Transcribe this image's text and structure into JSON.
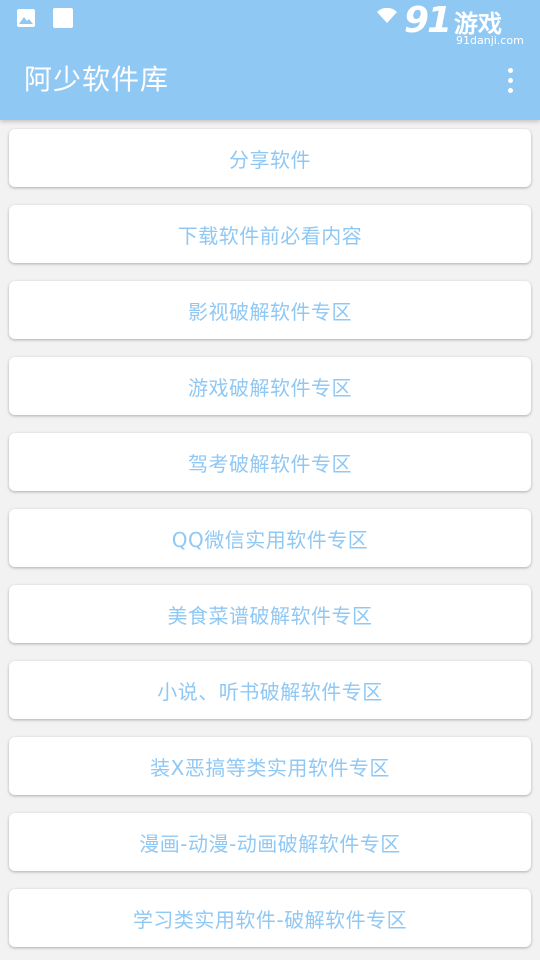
{
  "statusbar": {
    "icons": [
      "image-icon",
      "square-icon",
      "wifi-icon"
    ],
    "watermark_number": "91",
    "watermark_text": "游戏",
    "watermark_url": "91danji.com"
  },
  "appbar": {
    "title": "阿少软件库",
    "menu_icon": "overflow-menu-icon",
    "color": "#90c8f4"
  },
  "colors": {
    "accent": "#90c8f4",
    "card_bg": "#ffffff",
    "page_bg": "#f2f2f2"
  },
  "menu": {
    "items": [
      {
        "label": "分享软件"
      },
      {
        "label": "下载软件前必看内容"
      },
      {
        "label": "影视破解软件专区"
      },
      {
        "label": "游戏破解软件专区"
      },
      {
        "label": "驾考破解软件专区"
      },
      {
        "label": "QQ微信实用软件专区"
      },
      {
        "label": "美食菜谱破解软件专区"
      },
      {
        "label": "小说、听书破解软件专区"
      },
      {
        "label": "装X恶搞等类实用软件专区"
      },
      {
        "label": "漫画-动漫-动画破解软件专区"
      },
      {
        "label": "学习类实用软件-破解软件专区"
      }
    ]
  }
}
